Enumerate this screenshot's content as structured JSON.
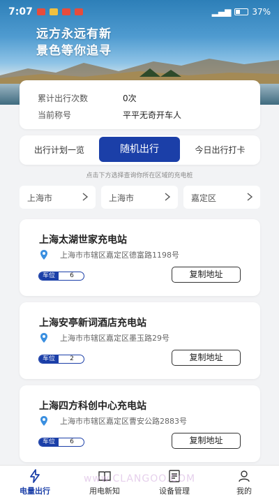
{
  "status_bar": {
    "time": "7:07",
    "battery": "37%"
  },
  "hero": {
    "slogan_line1": "远方永远有新",
    "slogan_line2": "景色等你追寻"
  },
  "stats": {
    "trips_label": "累计出行次数",
    "trips_value": "0次",
    "title_label": "当前称号",
    "title_value": "平平无奇开车人"
  },
  "tabs": {
    "plan": "出行计划一览",
    "random": "随机出行",
    "checkin": "今日出行打卡"
  },
  "hint": "点击下方选择查询你所在区域的充电桩",
  "region": {
    "province": "上海市",
    "city": "上海市",
    "district": "嘉定区"
  },
  "stations": [
    {
      "name": "上海太湖世家充电站",
      "address": "上海市市辖区嘉定区德富路1198号",
      "slot_label": "车位",
      "slots": "6",
      "copy_label": "复制地址"
    },
    {
      "name": "上海安亭新词酒店充电站",
      "address": "上海市市辖区嘉定区墨玉路29号",
      "slot_label": "车位",
      "slots": "2",
      "copy_label": "复制地址"
    },
    {
      "name": "上海四方科创中心充电站",
      "address": "上海市市辖区嘉定区曹安公路2883号",
      "slot_label": "车位",
      "slots": "6",
      "copy_label": "复制地址"
    }
  ],
  "nav": {
    "charge": "电量出行",
    "news": "用电新知",
    "device": "设备管理",
    "mine": "我的"
  },
  "watermark": "www.CLANGOO.COM",
  "colors": {
    "accent": "#1b3fa8",
    "pin": "#3a8fe0"
  }
}
